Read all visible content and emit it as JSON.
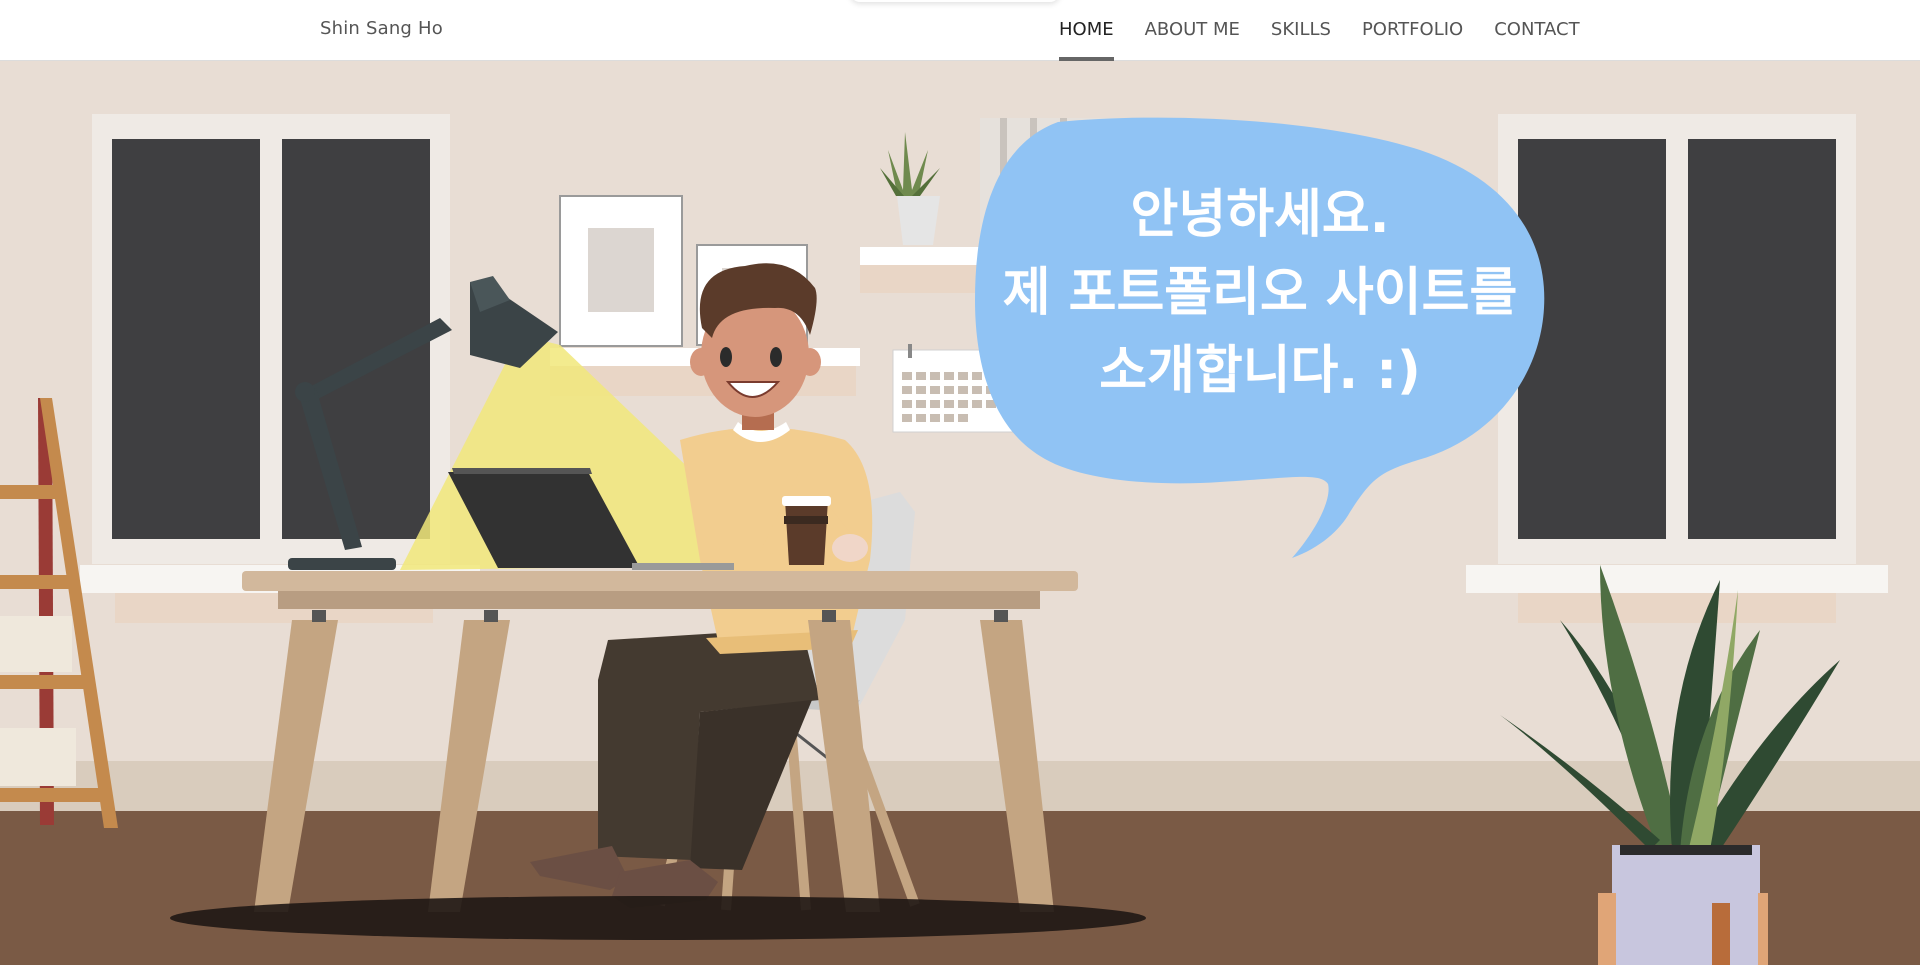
{
  "header": {
    "brand": "Shin Sang Ho",
    "menu": [
      {
        "label": "HOME",
        "active": true
      },
      {
        "label": "ABOUT ME",
        "active": false
      },
      {
        "label": "SKILLS",
        "active": false
      },
      {
        "label": "PORTFOLIO",
        "active": false
      },
      {
        "label": "CONTACT",
        "active": false
      }
    ]
  },
  "hero": {
    "greeting_lines": [
      "안녕하세요.",
      "제 포트폴리오 사이트를",
      "소개합니다. :)"
    ],
    "bubble_color": "#90c3f4",
    "wall_color": "#e8ddd4",
    "floor_color": "#7a5a45"
  }
}
